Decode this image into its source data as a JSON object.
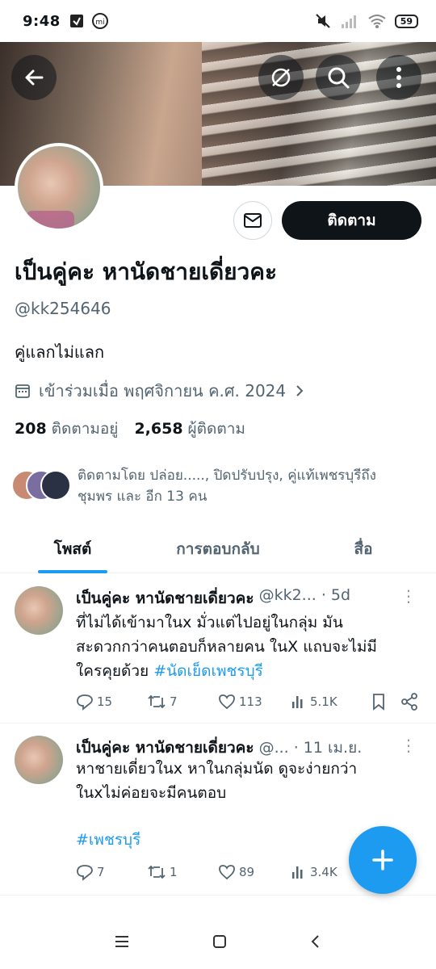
{
  "status_bar": {
    "time": "9:48",
    "battery": "59"
  },
  "profile": {
    "display_name": "เป็นคู่คะ หานัดชายเดี่ยวคะ",
    "handle": "@kk254646",
    "bio": "คู่แลกไม่แลก",
    "joined": "เข้าร่วมเมื่อ พฤศจิกายน ค.ศ. 2024",
    "following_count": "208",
    "following_label": "ติดตามอยู่",
    "followers_count": "2,658",
    "followers_label": "ผู้ติดตาม",
    "followed_by_line1": "ติดตามโดย ปล่อย....., ปิดปรับปรุง, คู่แท้เพชรบุรีถึง",
    "followed_by_line2": "ชุมพร และ อีก 13 คน",
    "follow_button": "ติดตาม"
  },
  "tabs": [
    {
      "label": "โพสต์"
    },
    {
      "label": "การตอบกลับ"
    },
    {
      "label": "สื่อ"
    }
  ],
  "tweets": [
    {
      "name": "เป็นคู่คะ หานัดชายเดี่ยวคะ",
      "meta": "@kk2... · 5d",
      "line1": "ที่ไม่ได้เข้ามาในx มั่วแต่ไปอยู่ในกลุ่ม มัน",
      "line2": "สะดวกกว่าคนตอบก็หลายคน ในX แถบจะไม่มี",
      "line3": "ใครคุยด้วย",
      "hashtag": "#นัดเย็ดเพชรบุรี",
      "replies": "15",
      "reposts": "7",
      "likes": "113",
      "views": "5.1K"
    },
    {
      "name": "เป็นคู่คะ หานัดชายเดี่ยวคะ",
      "meta": "@... · 11 เม.ย.",
      "line1": "หาชายเดี่ยวในx หาในกลุ่มนัด ดูจะง่ายกว่า",
      "line2": "ในxไม่ค่อยจะมีคนตอบ",
      "hashtag": "#เพชรบุรี",
      "replies": "7",
      "reposts": "1",
      "likes": "89",
      "views": "3.4K"
    }
  ],
  "colors": {
    "accent": "#1d9bf0",
    "text_primary": "#0f1419",
    "text_secondary": "#536471"
  }
}
